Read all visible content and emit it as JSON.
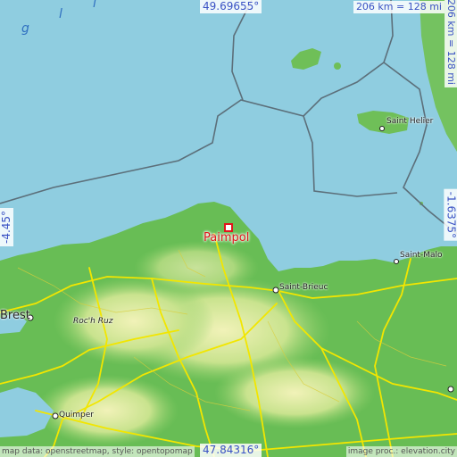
{
  "coords": {
    "top": "49.69655°",
    "bottom": "47.84316°",
    "left": "-4.45°",
    "right": "-1.6375°"
  },
  "scale": {
    "top": "206 km = 128 mi",
    "right": "206 km = 128 mi"
  },
  "attribution": {
    "left": "map data: openstreetmap, style: opentopomap",
    "right": "image proc.: elevation.city"
  },
  "places": {
    "main": "Paimpol",
    "saint_helier": "Saint Helier",
    "saint_malo": "Saint-Malo",
    "saint_brieuc": "Saint-Brieuc",
    "brest": "Brest",
    "quimper": "Quimper",
    "roch_ruz": "Roc'h Ruz"
  },
  "sea_labels": [
    "g",
    "l",
    "l"
  ],
  "colors": {
    "sea": "#8fcde0",
    "land": "#6bbf5a",
    "highland": "#e4e79a",
    "roads": "#f2e600",
    "borders": "#5c6f7a",
    "marker": "#e0161b",
    "coord_text": "#3a52c4"
  }
}
